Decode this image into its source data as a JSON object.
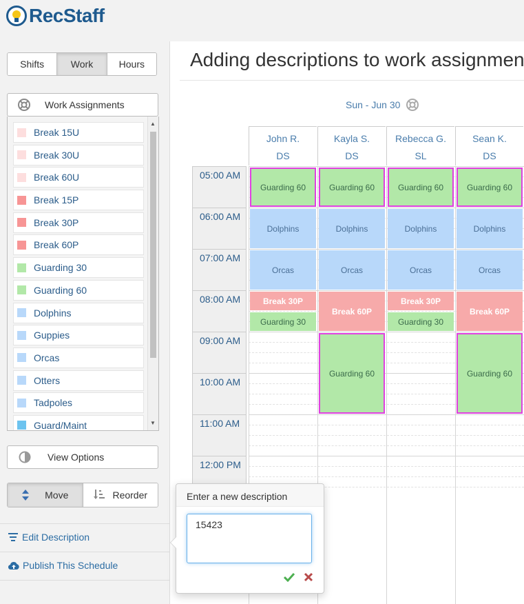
{
  "brand": {
    "name": "RecStaff"
  },
  "tabs": [
    {
      "label": "Shifts",
      "active": false
    },
    {
      "label": "Work",
      "active": true
    },
    {
      "label": "Hours",
      "active": false
    }
  ],
  "work_assignments": {
    "header": "Work Assignments",
    "items": [
      {
        "label": "Break 15U",
        "color": "#fddede"
      },
      {
        "label": "Break 30U",
        "color": "#fddede"
      },
      {
        "label": "Break 60U",
        "color": "#fddede"
      },
      {
        "label": "Break 15P",
        "color": "#f79595"
      },
      {
        "label": "Break 30P",
        "color": "#f79595"
      },
      {
        "label": "Break 60P",
        "color": "#f79595"
      },
      {
        "label": "Guarding 30",
        "color": "#b2e8a8"
      },
      {
        "label": "Guarding 60",
        "color": "#b2e8a8"
      },
      {
        "label": "Dolphins",
        "color": "#b8d8fa"
      },
      {
        "label": "Guppies",
        "color": "#b8d8fa"
      },
      {
        "label": "Orcas",
        "color": "#b8d8fa"
      },
      {
        "label": "Otters",
        "color": "#b8d8fa"
      },
      {
        "label": "Tadpoles",
        "color": "#b8d8fa"
      },
      {
        "label": "Guard/Maint",
        "color": "#6cc3ef"
      }
    ]
  },
  "view_options": {
    "label": "View Options"
  },
  "mode": {
    "move_label": "Move",
    "reorder_label": "Reorder"
  },
  "links": {
    "edit_description": "Edit Description",
    "publish": "Publish This Schedule"
  },
  "main": {
    "title": "Adding descriptions to work assignments",
    "day": "Sun - Jun 30"
  },
  "schedule": {
    "staff": [
      {
        "name": "John R.",
        "role": "DS"
      },
      {
        "name": "Kayla S.",
        "role": "DS"
      },
      {
        "name": "Rebecca G.",
        "role": "SL"
      },
      {
        "name": "Sean K.",
        "role": "DS"
      }
    ],
    "times": [
      "05:00 AM",
      "06:00 AM",
      "07:00 AM",
      "08:00 AM",
      "09:00 AM",
      "10:00 AM",
      "11:00 AM",
      "12:00 PM"
    ],
    "assignments": [
      {
        "staff": 0,
        "start": "05:00",
        "end": "06:00",
        "label": "Guarding 60",
        "kind": "guard",
        "selected": true
      },
      {
        "staff": 1,
        "start": "05:00",
        "end": "06:00",
        "label": "Guarding 60",
        "kind": "guard",
        "selected": true
      },
      {
        "staff": 2,
        "start": "05:00",
        "end": "06:00",
        "label": "Guarding 60",
        "kind": "guard",
        "selected": true
      },
      {
        "staff": 3,
        "start": "05:00",
        "end": "06:00",
        "label": "Guarding 60",
        "kind": "guard",
        "selected": true
      },
      {
        "staff": 0,
        "start": "06:00",
        "end": "07:00",
        "label": "Dolphins",
        "kind": "lesson",
        "selected": false
      },
      {
        "staff": 1,
        "start": "06:00",
        "end": "07:00",
        "label": "Dolphins",
        "kind": "lesson",
        "selected": false
      },
      {
        "staff": 2,
        "start": "06:00",
        "end": "07:00",
        "label": "Dolphins",
        "kind": "lesson",
        "selected": false
      },
      {
        "staff": 3,
        "start": "06:00",
        "end": "07:00",
        "label": "Dolphins",
        "kind": "lesson",
        "selected": false
      },
      {
        "staff": 0,
        "start": "07:00",
        "end": "08:00",
        "label": "Orcas",
        "kind": "lesson",
        "selected": false
      },
      {
        "staff": 1,
        "start": "07:00",
        "end": "08:00",
        "label": "Orcas",
        "kind": "lesson",
        "selected": false
      },
      {
        "staff": 2,
        "start": "07:00",
        "end": "08:00",
        "label": "Orcas",
        "kind": "lesson",
        "selected": false
      },
      {
        "staff": 3,
        "start": "07:00",
        "end": "08:00",
        "label": "Orcas",
        "kind": "lesson",
        "selected": false
      },
      {
        "staff": 0,
        "start": "08:00",
        "end": "08:30",
        "label": "Break 30P",
        "kind": "break",
        "selected": false
      },
      {
        "staff": 0,
        "start": "08:30",
        "end": "09:00",
        "label": "Guarding 30",
        "kind": "guard",
        "selected": false
      },
      {
        "staff": 1,
        "start": "08:00",
        "end": "09:00",
        "label": "Break 60P",
        "kind": "break",
        "selected": false
      },
      {
        "staff": 2,
        "start": "08:00",
        "end": "08:30",
        "label": "Break 30P",
        "kind": "break",
        "selected": false
      },
      {
        "staff": 2,
        "start": "08:30",
        "end": "09:00",
        "label": "Guarding 30",
        "kind": "guard",
        "selected": false
      },
      {
        "staff": 3,
        "start": "08:00",
        "end": "09:00",
        "label": "Break 60P",
        "kind": "break",
        "selected": false
      },
      {
        "staff": 1,
        "start": "09:00",
        "end": "11:00",
        "label": "Guarding 60",
        "kind": "guard",
        "selected": true
      },
      {
        "staff": 3,
        "start": "09:00",
        "end": "11:00",
        "label": "Guarding 60",
        "kind": "guard",
        "selected": true
      }
    ],
    "colors": {
      "guard": "#b2e8a8",
      "lesson": "#b8d8fa",
      "break": "#f7aaaa",
      "selected_border": "#e040e0"
    }
  },
  "popover": {
    "title": "Enter a new description",
    "value": "15423"
  }
}
